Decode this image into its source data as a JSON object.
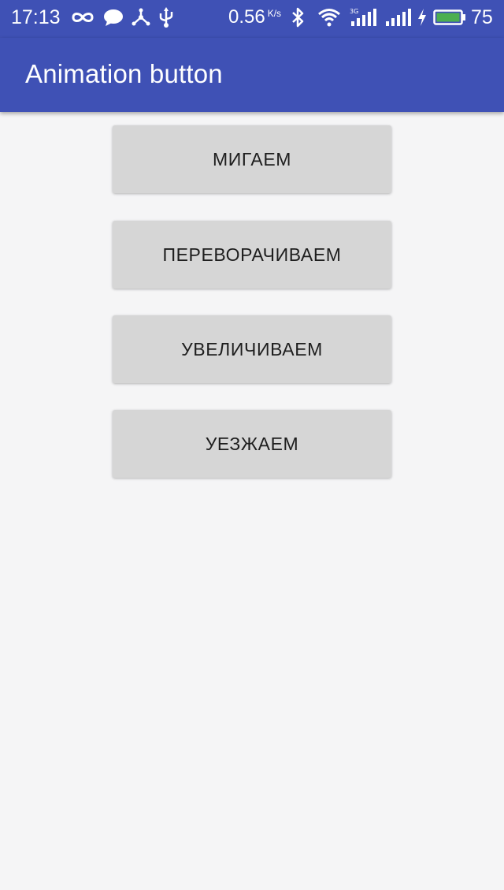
{
  "status_bar": {
    "time": "17:13",
    "network_speed": "0.56",
    "network_speed_unit": "K/s",
    "battery_percent": "75",
    "icons": [
      "infinity-icon",
      "chat-bubble-icon",
      "nodes-icon",
      "usb-icon",
      "bluetooth-icon",
      "wifi-icon",
      "signal-3g-icon",
      "signal-icon",
      "charging-icon",
      "battery-icon"
    ],
    "battery_color": "#4caf50"
  },
  "app_bar": {
    "title": "Animation button",
    "color": "#3f51b5"
  },
  "buttons": [
    {
      "label": "МИГАЕМ"
    },
    {
      "label": "ПЕРЕВОРАЧИВАЕМ"
    },
    {
      "label": "УВЕЛИЧИВАЕМ"
    },
    {
      "label": "УЕЗЖАЕМ"
    }
  ]
}
